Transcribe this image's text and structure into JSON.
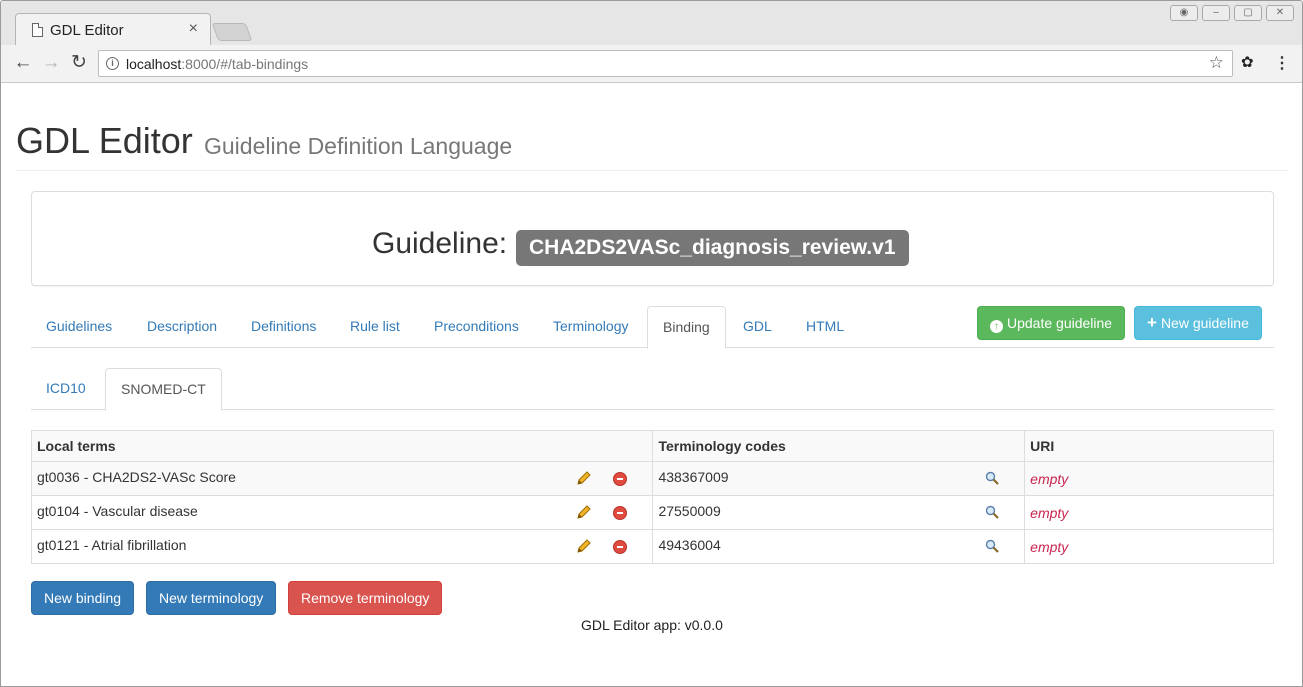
{
  "browser": {
    "tab_title": "GDL Editor",
    "tab_close": "×",
    "url_host": "localhost",
    "url_rest": ":8000/#/tab-bindings"
  },
  "header": {
    "title": "GDL Editor",
    "subtitle": "Guideline Definition Language"
  },
  "guideline": {
    "label": "Guideline:",
    "name": "CHA2DS2VASc_diagnosis_review.v1"
  },
  "main_tabs": [
    "Guidelines",
    "Description",
    "Definitions",
    "Rule list",
    "Preconditions",
    "Terminology",
    "Binding",
    "GDL",
    "HTML"
  ],
  "active_main_tab": "Binding",
  "actions": {
    "update": "Update guideline",
    "new": "New guideline"
  },
  "sub_tabs": [
    "ICD10",
    "SNOMED-CT"
  ],
  "active_sub_tab": "SNOMED-CT",
  "table": {
    "headers": [
      "Local terms",
      "Terminology codes",
      "URI"
    ],
    "rows": [
      {
        "term": "gt0036 - CHA2DS2-VASc Score",
        "code": "438367009",
        "uri": "empty"
      },
      {
        "term": "gt0104 - Vascular disease",
        "code": "27550009",
        "uri": "empty"
      },
      {
        "term": "gt0121 - Atrial fibrillation",
        "code": "49436004",
        "uri": "empty"
      }
    ]
  },
  "buttons": {
    "new_binding": "New binding",
    "new_terminology": "New terminology",
    "remove_terminology": "Remove terminology"
  },
  "footer": "GDL Editor app: v0.0.0"
}
